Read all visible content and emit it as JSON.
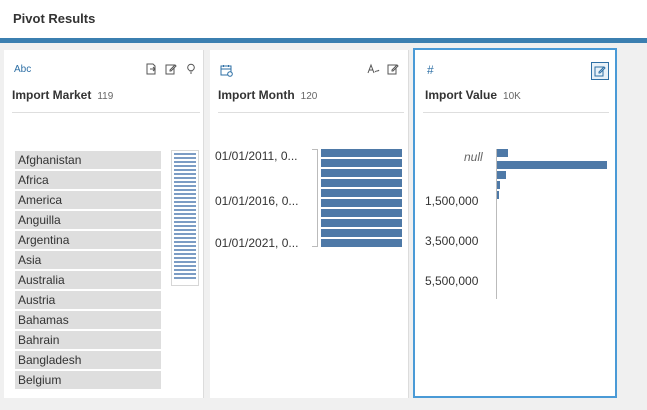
{
  "header": {
    "title": "Pivot Results"
  },
  "colors": {
    "accent": "#3b7fb0",
    "bar": "#4e79a7",
    "selected_border": "#4a9ad6"
  },
  "cards": {
    "market": {
      "type_label": "Abc",
      "name": "Import Market",
      "count": "119",
      "icons": [
        "expand-icon",
        "edit-icon",
        "lightbulb-icon"
      ],
      "items": [
        "Afghanistan",
        "Africa",
        "America",
        "Anguilla",
        "Argentina",
        "Asia",
        "Australia",
        "Austria",
        "Bahamas",
        "Bahrain",
        "Bangladesh",
        "Belgium"
      ]
    },
    "month": {
      "type_icon": "calendar-icon",
      "name": "Import Month",
      "count": "120",
      "icons": [
        "text-format-icon",
        "edit-icon"
      ],
      "labels": [
        "01/01/2011, 0...",
        "01/01/2016, 0...",
        "01/01/2021, 0..."
      ],
      "bar_count": 10
    },
    "value": {
      "type_label": "#",
      "name": "Import Value",
      "count": "10K",
      "icons": [
        "edit-icon"
      ],
      "labels": [
        "null",
        "1,500,000",
        "3,500,000",
        "5,500,000"
      ],
      "bins": [
        0.1,
        1.0,
        0.08,
        0.03,
        0.01
      ]
    }
  }
}
